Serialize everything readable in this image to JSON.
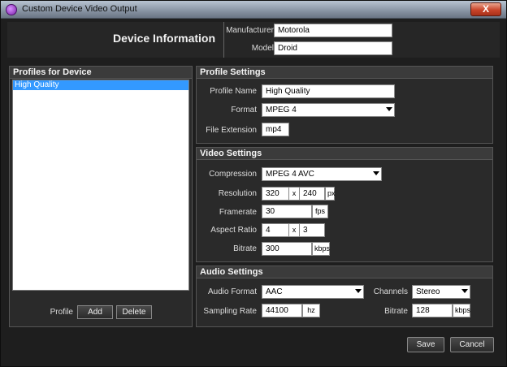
{
  "window": {
    "title": "Custom Device Video Output",
    "close_label": "X"
  },
  "header": {
    "title": "Device Information",
    "manufacturer_label": "Manufacturer",
    "manufacturer_value": "Motorola",
    "model_label": "Model",
    "model_value": "Droid"
  },
  "profiles": {
    "title": "Profiles for Device",
    "items": [
      "High Quality"
    ],
    "profile_label": "Profile",
    "add_label": "Add",
    "delete_label": "Delete"
  },
  "profile_settings": {
    "title": "Profile Settings",
    "name_label": "Profile Name",
    "name_value": "High Quality",
    "format_label": "Format",
    "format_value": "MPEG 4",
    "ext_label": "File Extension",
    "ext_value": "mp4"
  },
  "video_settings": {
    "title": "Video Settings",
    "compression_label": "Compression",
    "compression_value": "MPEG 4 AVC",
    "resolution_label": "Resolution",
    "res_w": "320",
    "res_x": "x",
    "res_h": "240",
    "res_unit": "px",
    "framerate_label": "Framerate",
    "framerate_value": "30",
    "framerate_unit": "fps",
    "aspect_label": "Aspect Ratio",
    "aspect_w": "4",
    "aspect_x": "x",
    "aspect_h": "3",
    "bitrate_label": "Bitrate",
    "bitrate_value": "300",
    "bitrate_unit": "kbps"
  },
  "audio_settings": {
    "title": "Audio Settings",
    "format_label": "Audio Format",
    "format_value": "AAC",
    "channels_label": "Channels",
    "channels_value": "Stereo",
    "sampling_label": "Sampling Rate",
    "sampling_value": "44100",
    "sampling_unit": "hz",
    "bitrate_label": "Bitrate",
    "bitrate_value": "128",
    "bitrate_unit": "kbps"
  },
  "footer": {
    "save_label": "Save",
    "cancel_label": "Cancel"
  }
}
